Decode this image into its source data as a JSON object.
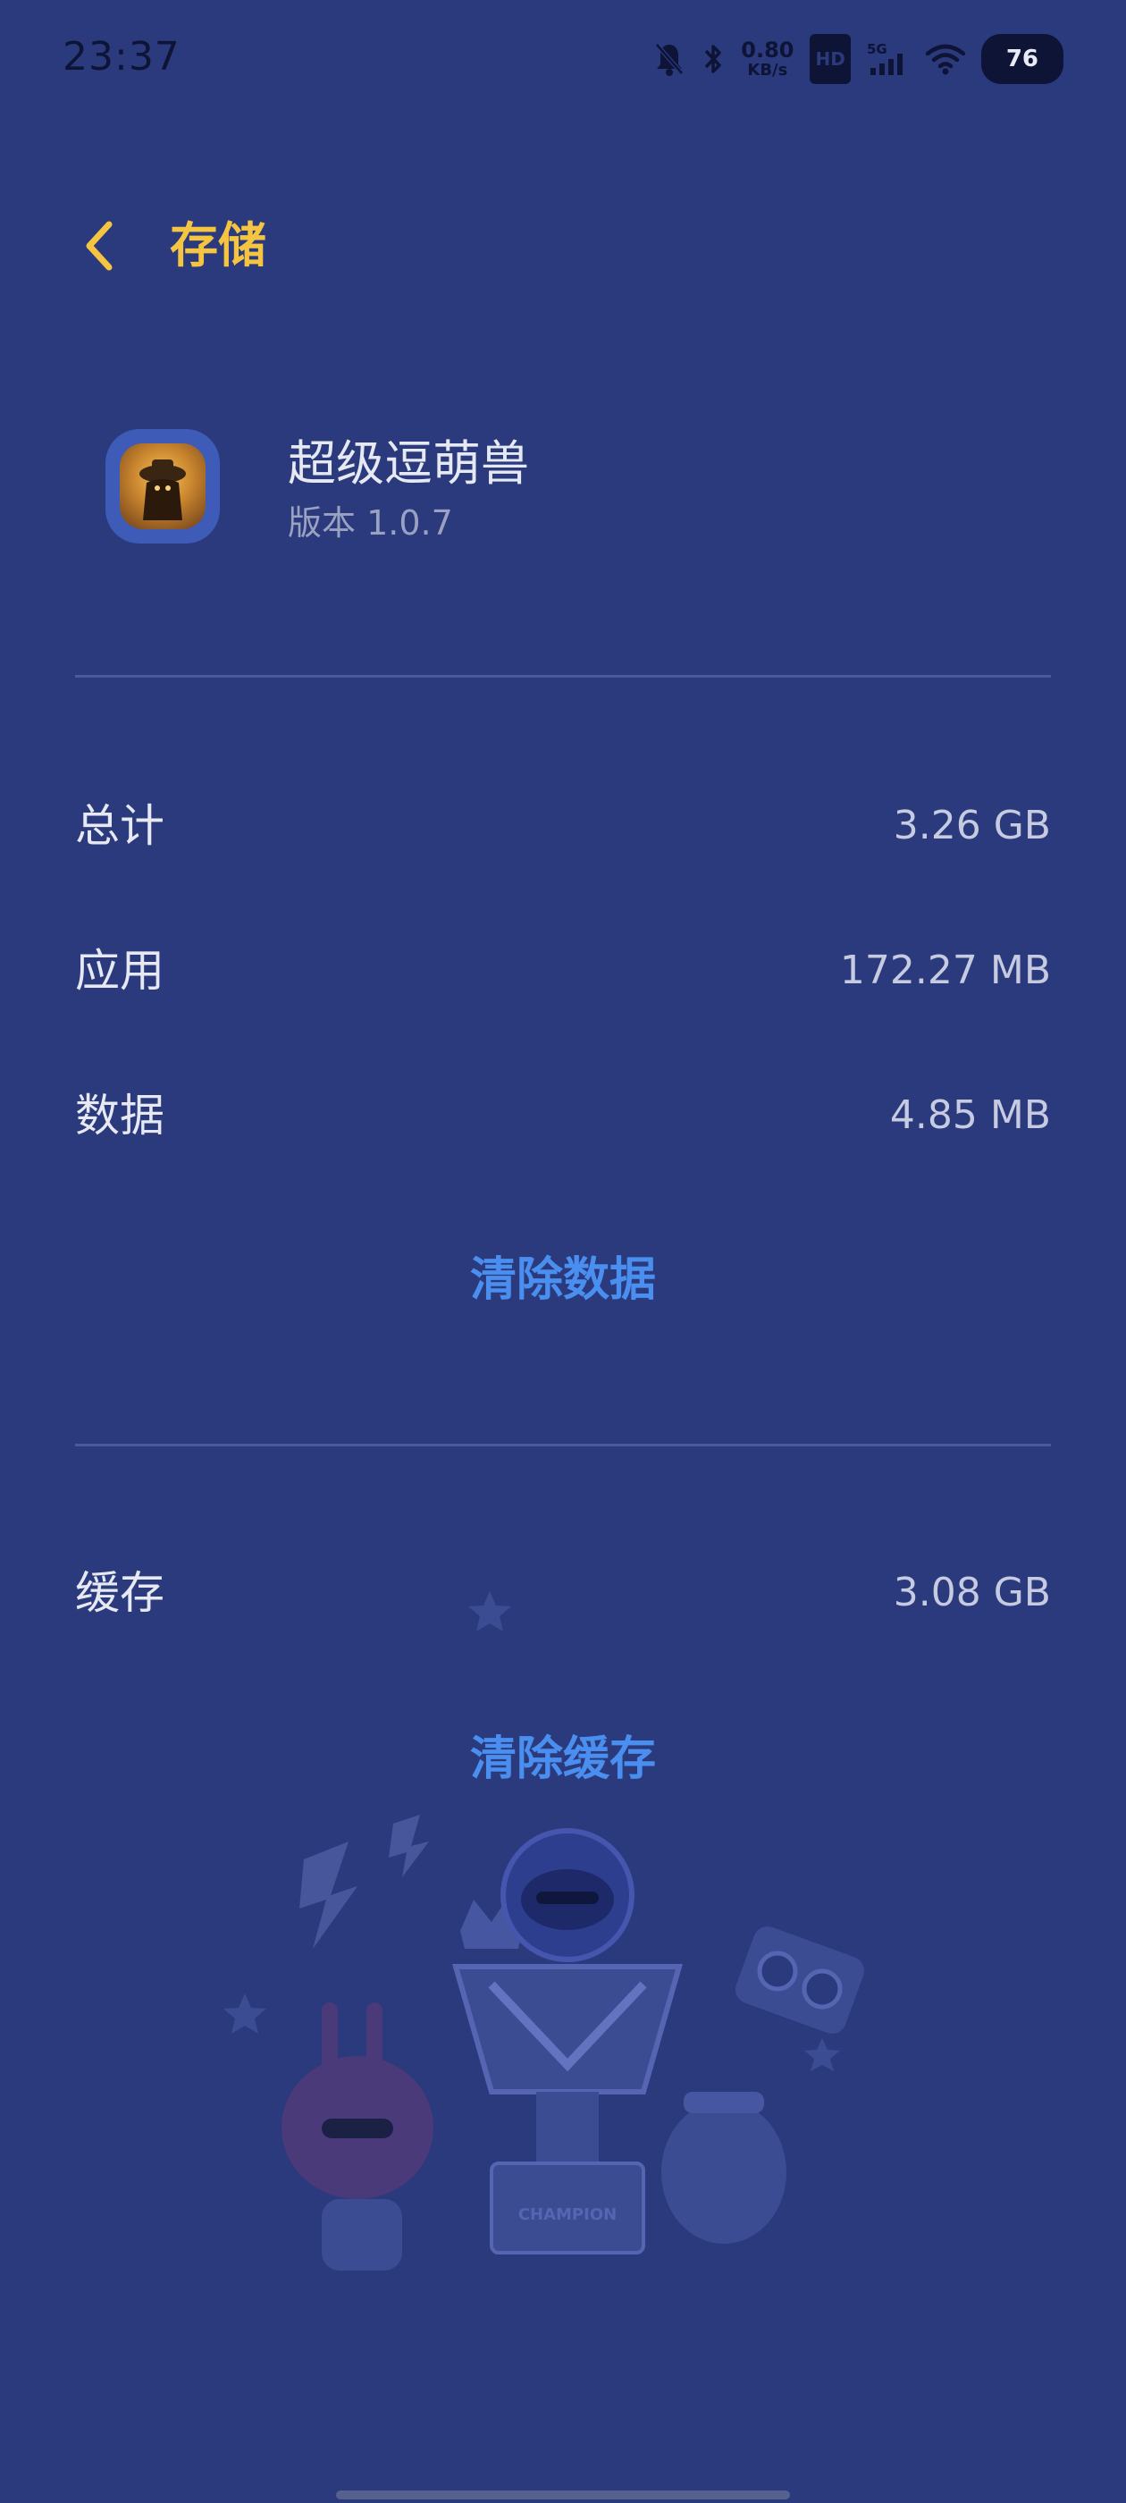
{
  "status_bar": {
    "time": "23:37",
    "net_speed_value": "0.80",
    "net_speed_unit": "KB/s",
    "hd_label": "HD",
    "signal_label": "5G",
    "battery": "76",
    "icons": [
      "mute-bell-icon",
      "bluetooth-icon",
      "signal-icon",
      "wifi-icon"
    ]
  },
  "header": {
    "title": "存储",
    "back_icon": "chevron-left-icon"
  },
  "app": {
    "name": "超级逗萌兽",
    "version": "版本 1.0.7"
  },
  "storage": {
    "total_label": "总计",
    "total_value": "3.26 GB",
    "app_label": "应用",
    "app_value": "172.27 MB",
    "data_label": "数据",
    "data_value": "4.85 MB",
    "clear_data_label": "清除数据",
    "cache_label": "缓存",
    "cache_value": "3.08 GB",
    "clear_cache_label": "清除缓存"
  },
  "illustration": {
    "trophy_text": "CHAMPION"
  },
  "colors": {
    "background": "#2a3a7c",
    "accent_title": "#f5c542",
    "action_blue": "#4a8ff0"
  }
}
